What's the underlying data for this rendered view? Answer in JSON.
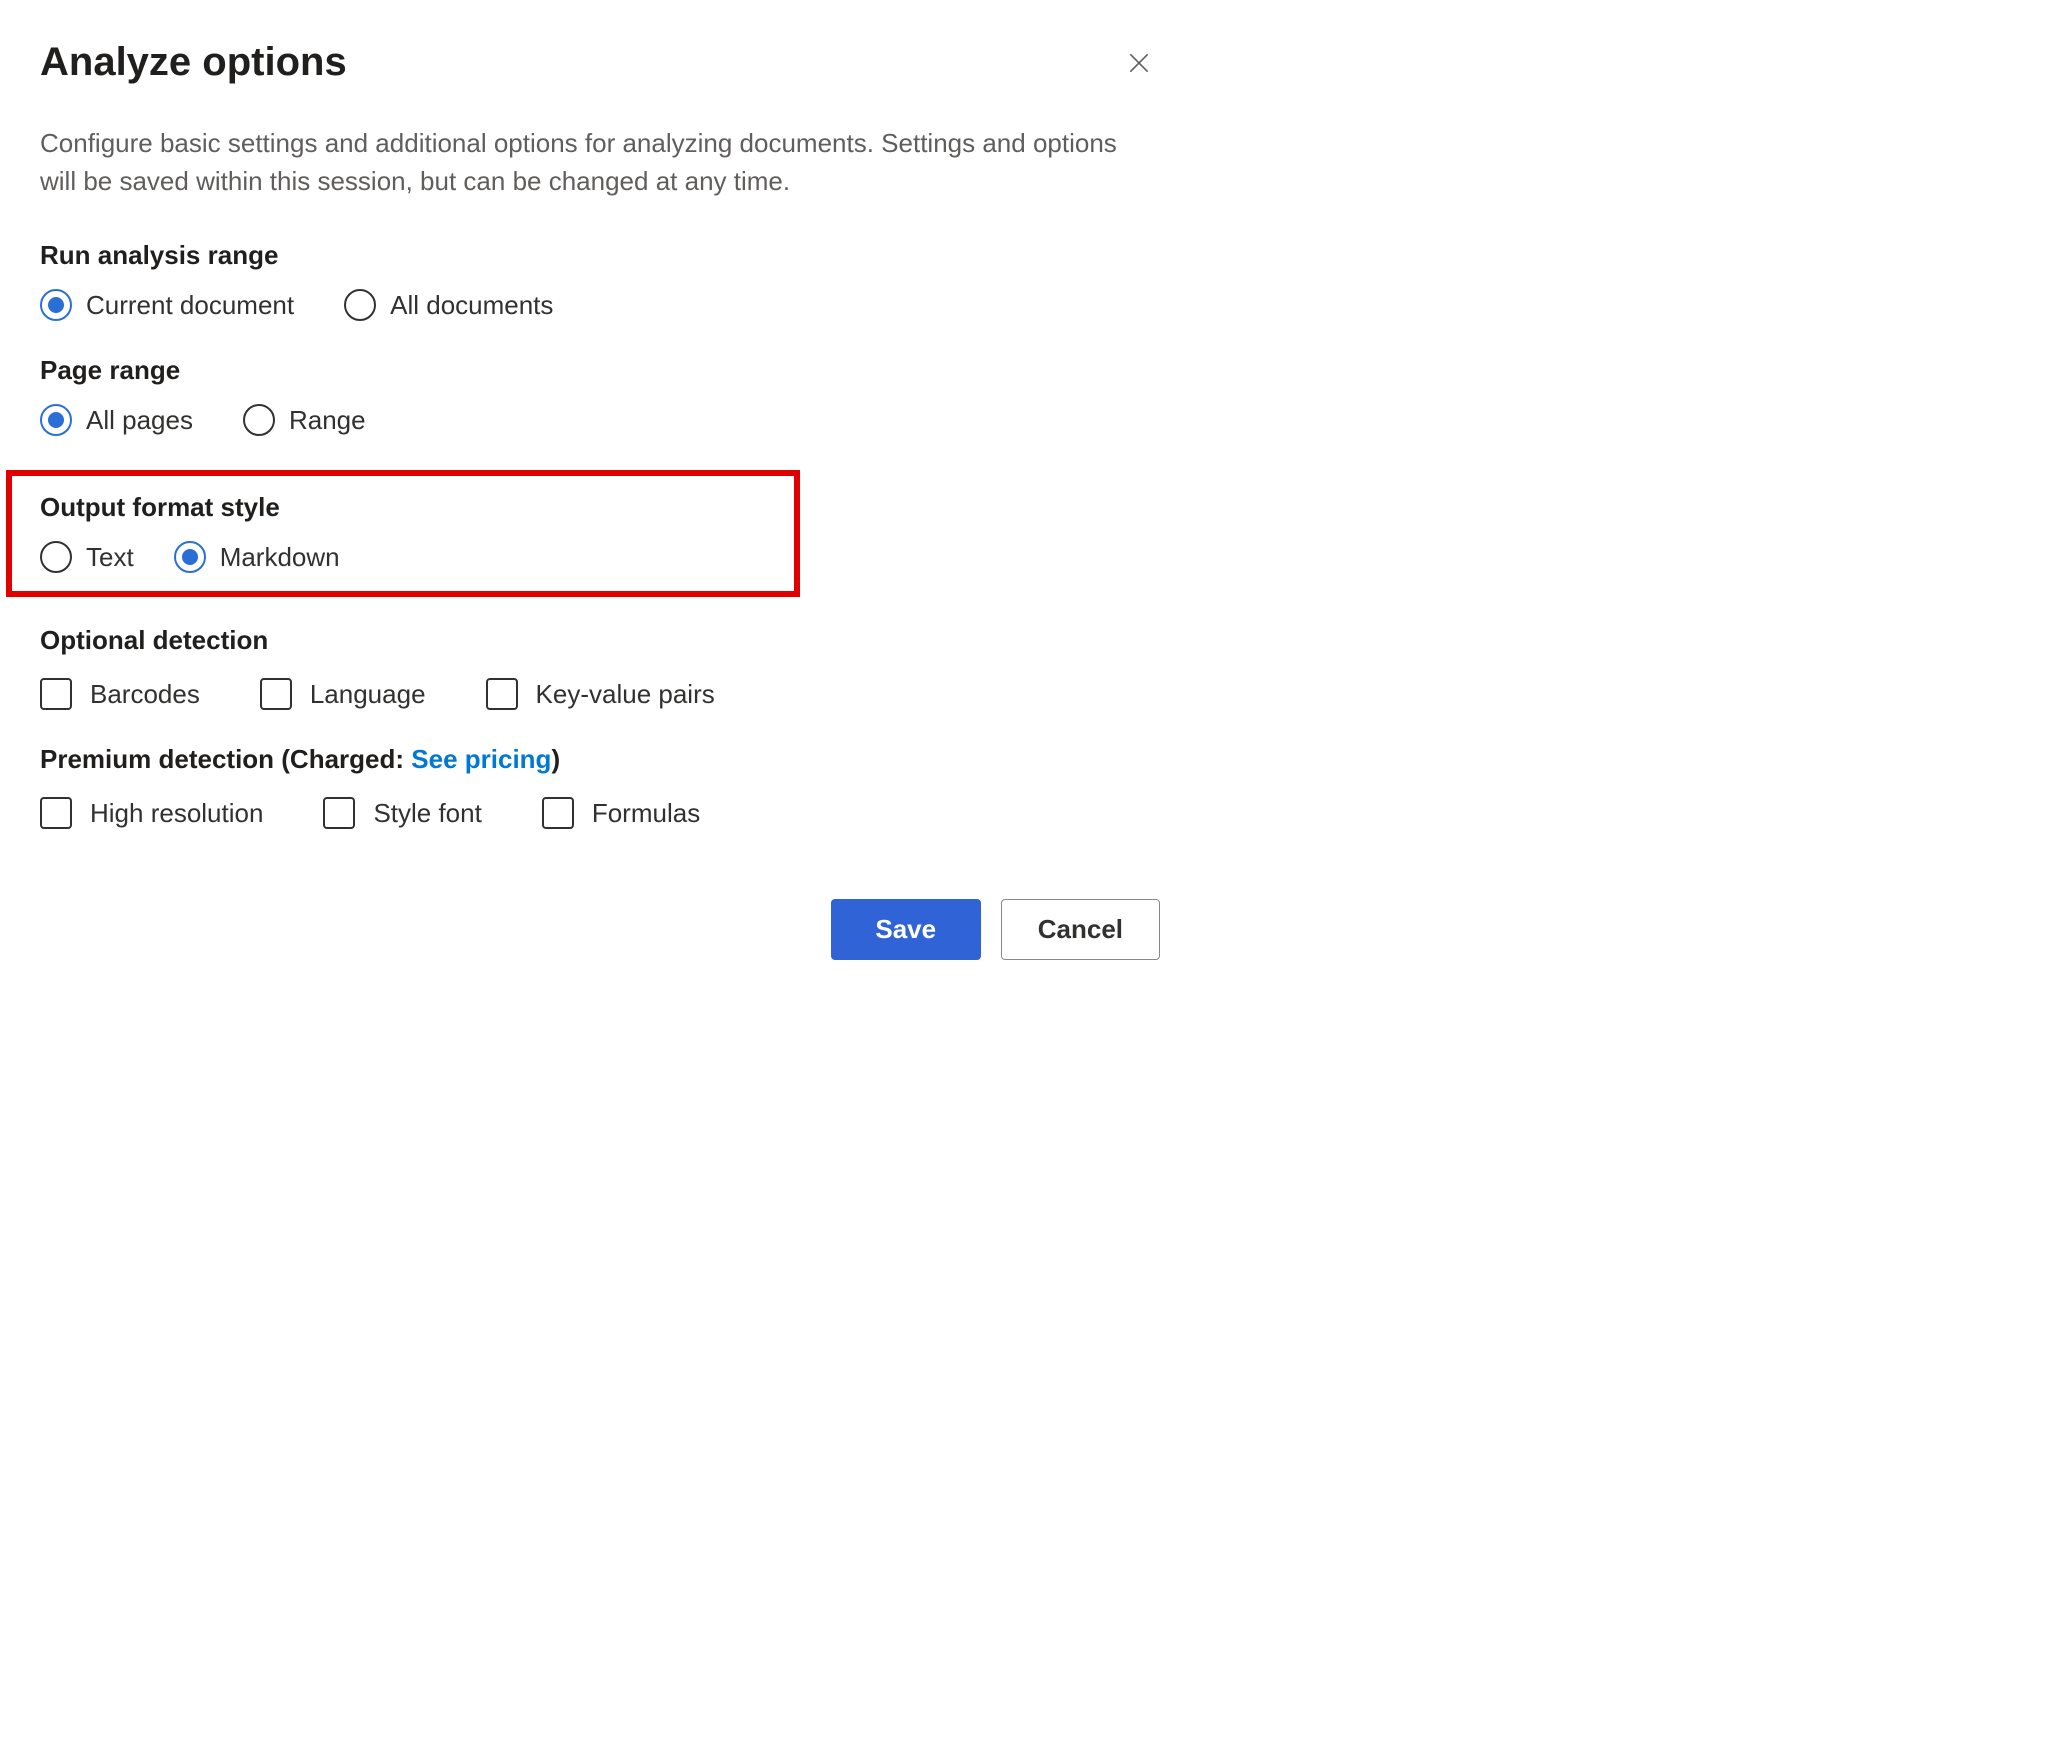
{
  "dialog": {
    "title": "Analyze options",
    "description": "Configure basic settings and additional options for analyzing documents. Settings and options will be saved within this session, but can be changed at any time."
  },
  "sections": {
    "analysisRange": {
      "title": "Run analysis range",
      "options": {
        "current": "Current document",
        "all": "All documents"
      },
      "selected": "current"
    },
    "pageRange": {
      "title": "Page range",
      "options": {
        "all": "All pages",
        "range": "Range"
      },
      "selected": "all"
    },
    "outputFormat": {
      "title": "Output format style",
      "options": {
        "text": "Text",
        "markdown": "Markdown"
      },
      "selected": "markdown"
    },
    "optionalDetection": {
      "title": "Optional detection",
      "options": {
        "barcodes": "Barcodes",
        "language": "Language",
        "kvp": "Key-value pairs"
      }
    },
    "premiumDetection": {
      "titlePrefix": "Premium detection (Charged: ",
      "link": "See pricing",
      "titleSuffix": ")",
      "options": {
        "highres": "High resolution",
        "stylefont": "Style font",
        "formulas": "Formulas"
      }
    }
  },
  "footer": {
    "save": "Save",
    "cancel": "Cancel"
  }
}
